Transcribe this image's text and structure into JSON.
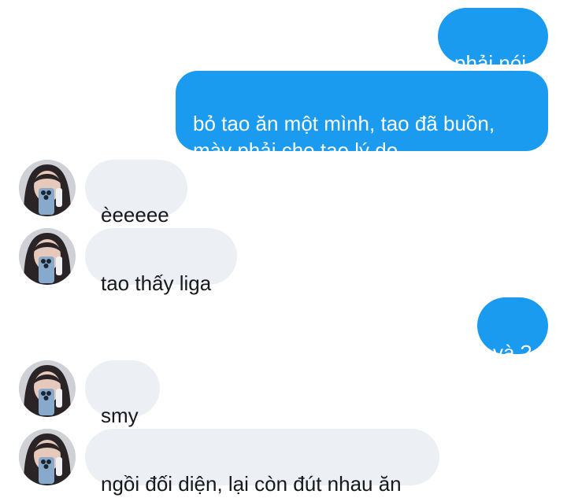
{
  "colors": {
    "sent_bubble": "#1a9bf0",
    "received_bubble": "#eceff3",
    "background": "#ffffff"
  },
  "messages": [
    {
      "direction": "sent",
      "text": "phải nói"
    },
    {
      "direction": "sent",
      "text": "bỏ tao ăn một mình, tao đã buồn,\nmày phải cho tao lý do"
    },
    {
      "direction": "received",
      "text": "èeeeee",
      "avatar": "contact-avatar"
    },
    {
      "direction": "received",
      "text": "tao thấy liga",
      "avatar": "contact-avatar"
    },
    {
      "direction": "sent",
      "text": "và ?"
    },
    {
      "direction": "received",
      "text": "smy",
      "avatar": "contact-avatar"
    },
    {
      "direction": "received",
      "text": "ngồi đối diện, lại còn đút nhau ăn",
      "avatar": "contact-avatar"
    }
  ]
}
